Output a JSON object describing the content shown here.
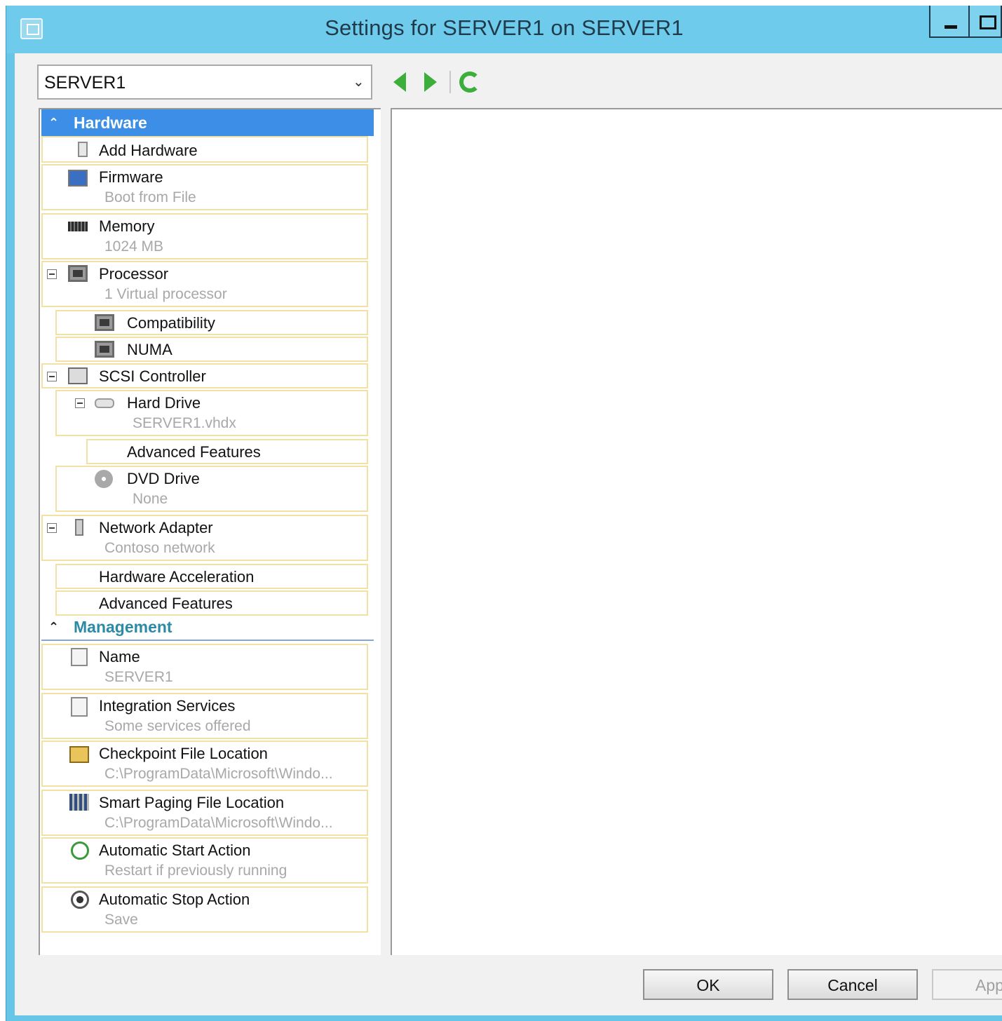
{
  "window": {
    "title": "Settings for SERVER1 on SERVER1"
  },
  "vm_selector": {
    "value": "SERVER1"
  },
  "toolbar": {
    "back_icon": "back-arrow-icon",
    "forward_icon": "forward-arrow-icon",
    "refresh_icon": "refresh-icon"
  },
  "sections": {
    "hardware": "Hardware",
    "management": "Management"
  },
  "hardware": [
    {
      "label": "Add Hardware",
      "sub": "",
      "icon": "add-hardware-icon"
    },
    {
      "label": "Firmware",
      "sub": "Boot from File",
      "icon": "firmware-icon"
    },
    {
      "label": "Memory",
      "sub": "1024 MB",
      "icon": "memory-icon"
    },
    {
      "label": "Processor",
      "sub": "1 Virtual processor",
      "icon": "processor-icon"
    },
    {
      "label": "Compatibility",
      "sub": "",
      "icon": "processor-icon"
    },
    {
      "label": "NUMA",
      "sub": "",
      "icon": "processor-icon"
    },
    {
      "label": "SCSI Controller",
      "sub": "",
      "icon": "scsi-controller-icon"
    },
    {
      "label": "Hard Drive",
      "sub": "SERVER1.vhdx",
      "icon": "hard-drive-icon"
    },
    {
      "label": "Advanced Features",
      "sub": "",
      "icon": ""
    },
    {
      "label": "DVD Drive",
      "sub": "None",
      "icon": "dvd-drive-icon"
    },
    {
      "label": "Network Adapter",
      "sub": "Contoso network",
      "icon": "network-adapter-icon"
    },
    {
      "label": "Hardware Acceleration",
      "sub": "",
      "icon": ""
    },
    {
      "label": "Advanced Features",
      "sub": "",
      "icon": ""
    }
  ],
  "management": [
    {
      "label": "Name",
      "sub": "SERVER1",
      "icon": "name-icon"
    },
    {
      "label": "Integration Services",
      "sub": "Some services offered",
      "icon": "integration-services-icon"
    },
    {
      "label": "Checkpoint File Location",
      "sub": "C:\\ProgramData\\Microsoft\\Windo...",
      "icon": "checkpoint-folder-icon"
    },
    {
      "label": "Smart Paging File Location",
      "sub": "C:\\ProgramData\\Microsoft\\Windo...",
      "icon": "smart-paging-icon"
    },
    {
      "label": "Automatic Start Action",
      "sub": "Restart if previously running",
      "icon": "start-action-icon"
    },
    {
      "label": "Automatic Stop Action",
      "sub": "Save",
      "icon": "stop-action-icon"
    }
  ],
  "buttons": {
    "ok": "OK",
    "cancel": "Cancel",
    "apply": "Appl"
  }
}
